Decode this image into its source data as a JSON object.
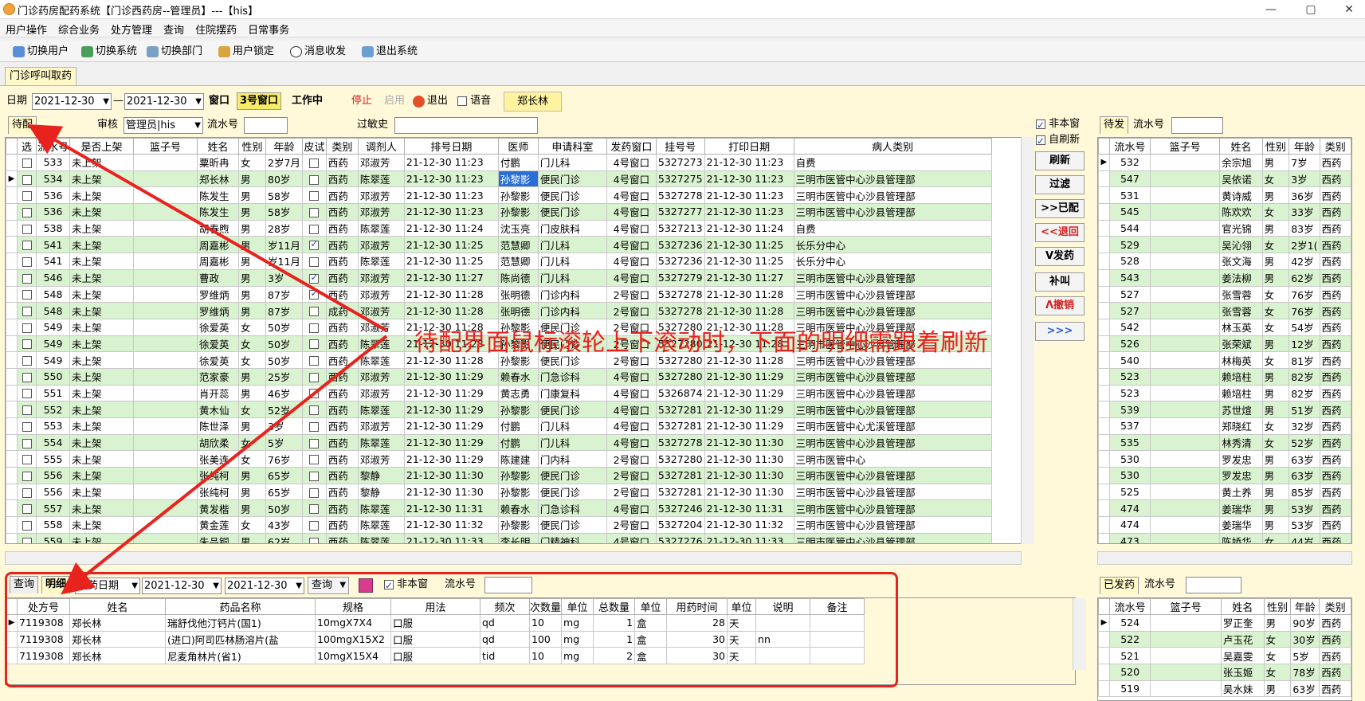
{
  "window": {
    "title": "门诊药房配药系统【门诊西药房--管理员】---【his】",
    "min": "—",
    "max": "▢",
    "close": "✕"
  },
  "menu": [
    "用户操作",
    "综合业务",
    "处方管理",
    "查询",
    "住院摆药",
    "日常事务"
  ],
  "toolbar": [
    "切换用户",
    "切换系统",
    "切换部门",
    "用户锁定",
    "消息收发",
    "退出系统"
  ],
  "module_tab": "门诊呼叫取药",
  "filter": {
    "date_label": "日期",
    "date_from": "2021-12-30",
    "dash": "—",
    "date_to": "2021-12-30",
    "window_label": "窗口",
    "window_value": "3号窗口",
    "status": "工作中",
    "stop": "停止",
    "enable": "启用",
    "exit": "退出",
    "voice": "语音",
    "user": "郑长林"
  },
  "left_tab": "待配",
  "review_label": "审核",
  "review_value": "管理员|his",
  "serial_label": "流水号",
  "allergy_label": "过敏史",
  "main_columns": [
    "选",
    "流水号",
    "是否上架",
    "篮子号",
    "姓名",
    "性别",
    "年龄",
    "皮试",
    "类别",
    "调剂人",
    "排号日期",
    "医师",
    "申请科室",
    "发药窗口",
    "挂号号",
    "打印日期",
    "病人类别"
  ],
  "main_rows": [
    [
      "533",
      "未上架",
      "",
      "粟昕冉",
      "女",
      "2岁7月",
      "0",
      "西药",
      "邓淑芳",
      "21-12-30 11:23",
      "付鹏",
      "门儿科",
      "4号窗口",
      "5327273",
      "21-12-30 11:23",
      "自费"
    ],
    [
      "534",
      "未上架",
      "",
      "郑长林",
      "男",
      "80岁",
      "0",
      "西药",
      "陈翠莲",
      "21-12-30 11:23",
      "孙黎影",
      "便民门诊",
      "4号窗口",
      "5327275",
      "21-12-30 11:23",
      "三明市医管中心沙县管理部"
    ],
    [
      "536",
      "未上架",
      "",
      "陈发生",
      "男",
      "58岁",
      "0",
      "西药",
      "邓淑芳",
      "21-12-30 11:23",
      "孙黎影",
      "便民门诊",
      "4号窗口",
      "5327278",
      "21-12-30 11:23",
      "三明市医管中心沙县管理部"
    ],
    [
      "536",
      "未上架",
      "",
      "陈发生",
      "男",
      "58岁",
      "0",
      "西药",
      "邓淑芳",
      "21-12-30 11:23",
      "孙黎影",
      "便民门诊",
      "4号窗口",
      "5327277",
      "21-12-30 11:23",
      "三明市医管中心沙县管理部"
    ],
    [
      "538",
      "未上架",
      "",
      "胡春煦",
      "男",
      "28岁",
      "0",
      "西药",
      "陈翠莲",
      "21-12-30 11:24",
      "沈玉亮",
      "门皮肤科",
      "4号窗口",
      "5327213",
      "21-12-30 11:24",
      "自费"
    ],
    [
      "541",
      "未上架",
      "",
      "周嘉彬",
      "男",
      "岁11月",
      "1",
      "西药",
      "邓淑芳",
      "21-12-30 11:25",
      "范慧卿",
      "门儿科",
      "4号窗口",
      "5327236",
      "21-12-30 11:25",
      "长乐分中心"
    ],
    [
      "541",
      "未上架",
      "",
      "周嘉彬",
      "男",
      "岁11月",
      "0",
      "西药",
      "陈翠莲",
      "21-12-30 11:25",
      "范慧卿",
      "门儿科",
      "4号窗口",
      "5327236",
      "21-12-30 11:25",
      "长乐分中心"
    ],
    [
      "546",
      "未上架",
      "",
      "曹政",
      "男",
      "3岁",
      "1",
      "西药",
      "邓淑芳",
      "21-12-30 11:27",
      "陈尚德",
      "门儿科",
      "4号窗口",
      "5327279",
      "21-12-30 11:27",
      "三明市医管中心沙县管理部"
    ],
    [
      "548",
      "未上架",
      "",
      "罗维炳",
      "男",
      "87岁",
      "1",
      "西药",
      "邓淑芳",
      "21-12-30 11:28",
      "张明德",
      "门诊内科",
      "2号窗口",
      "5327278",
      "21-12-30 11:28",
      "三明市医管中心沙县管理部"
    ],
    [
      "548",
      "未上架",
      "",
      "罗维炳",
      "男",
      "87岁",
      "0",
      "成药",
      "邓淑芳",
      "21-12-30 11:28",
      "张明德",
      "门诊内科",
      "2号窗口",
      "5327278",
      "21-12-30 11:28",
      "三明市医管中心沙县管理部"
    ],
    [
      "549",
      "未上架",
      "",
      "徐爱英",
      "女",
      "50岁",
      "0",
      "西药",
      "邓淑芳",
      "21-12-30 11:28",
      "孙黎影",
      "便民门诊",
      "2号窗口",
      "5327280",
      "21-12-30 11:28",
      "三明市医管中心沙县管理部"
    ],
    [
      "549",
      "未上架",
      "",
      "徐爱英",
      "女",
      "50岁",
      "0",
      "西药",
      "陈翠莲",
      "21-12-30 11:28",
      "孙黎影",
      "便民门诊",
      "2号窗口",
      "5327280",
      "21-12-30 11:28",
      "三明市医管中心沙县管理部"
    ],
    [
      "549",
      "未上架",
      "",
      "徐爱英",
      "女",
      "50岁",
      "0",
      "西药",
      "陈翠莲",
      "21-12-30 11:28",
      "孙黎影",
      "便民门诊",
      "2号窗口",
      "5327280",
      "21-12-30 11:28",
      "三明市医管中心沙县管理部"
    ],
    [
      "550",
      "未上架",
      "",
      "范家豪",
      "男",
      "25岁",
      "0",
      "西药",
      "邓淑芳",
      "21-12-30 11:29",
      "赖春水",
      "门急诊科",
      "4号窗口",
      "5327280",
      "21-12-30 11:29",
      "三明市医管中心沙县管理部"
    ],
    [
      "551",
      "未上架",
      "",
      "肖开蕊",
      "男",
      "46岁",
      "0",
      "西药",
      "邓淑芳",
      "21-12-30 11:29",
      "黄志勇",
      "门康复科",
      "4号窗口",
      "5326874",
      "21-12-30 11:29",
      "三明市医管中心沙县管理部"
    ],
    [
      "552",
      "未上架",
      "",
      "黄木仙",
      "女",
      "52岁",
      "0",
      "西药",
      "陈翠莲",
      "21-12-30 11:29",
      "孙黎影",
      "便民门诊",
      "4号窗口",
      "5327281",
      "21-12-30 11:29",
      "三明市医管中心沙县管理部"
    ],
    [
      "553",
      "未上架",
      "",
      "陈世泽",
      "男",
      "3岁",
      "0",
      "西药",
      "邓淑芳",
      "21-12-30 11:29",
      "付鹏",
      "门儿科",
      "4号窗口",
      "5327281",
      "21-12-30 11:29",
      "三明市医管中心尤溪管理部"
    ],
    [
      "554",
      "未上架",
      "",
      "胡欣柔",
      "女",
      "5岁",
      "0",
      "西药",
      "陈翠莲",
      "21-12-30 11:29",
      "付鹏",
      "门儿科",
      "4号窗口",
      "5327278",
      "21-12-30 11:30",
      "三明市医管中心沙县管理部"
    ],
    [
      "555",
      "未上架",
      "",
      "张美连",
      "女",
      "76岁",
      "0",
      "西药",
      "邓淑芳",
      "21-12-30 11:29",
      "陈建建",
      "门内科",
      "2号窗口",
      "5327280",
      "21-12-30 11:30",
      "三明市医管中心"
    ],
    [
      "556",
      "未上架",
      "",
      "张纯柯",
      "男",
      "65岁",
      "0",
      "西药",
      "黎静",
      "21-12-30 11:30",
      "孙黎影",
      "便民门诊",
      "2号窗口",
      "5327281",
      "21-12-30 11:30",
      "三明市医管中心沙县管理部"
    ],
    [
      "556",
      "未上架",
      "",
      "张纯柯",
      "男",
      "65岁",
      "0",
      "西药",
      "黎静",
      "21-12-30 11:30",
      "孙黎影",
      "便民门诊",
      "2号窗口",
      "5327281",
      "21-12-30 11:30",
      "三明市医管中心沙县管理部"
    ],
    [
      "557",
      "未上架",
      "",
      "黄发楷",
      "男",
      "50岁",
      "0",
      "西药",
      "陈翠莲",
      "21-12-30 11:31",
      "赖春水",
      "门急诊科",
      "4号窗口",
      "5327246",
      "21-12-30 11:31",
      "三明市医管中心沙县管理部"
    ],
    [
      "558",
      "未上架",
      "",
      "黄金莲",
      "女",
      "43岁",
      "0",
      "西药",
      "陈翠莲",
      "21-12-30 11:32",
      "孙黎影",
      "便民门诊",
      "2号窗口",
      "5327204",
      "21-12-30 11:32",
      "三明市医管中心沙县管理部"
    ],
    [
      "559",
      "未上架",
      "",
      "朱品铜",
      "男",
      "62岁",
      "0",
      "西药",
      "陈翠莲",
      "21-12-30 11:33",
      "李长明",
      "门精神科",
      "4号窗口",
      "5327276",
      "21-12-30 11:33",
      "三明市医管中心沙县管理部"
    ]
  ],
  "side": {
    "chk1": "非本窗",
    "chk2": "自刷新",
    "buttons": [
      "刷新",
      "过滤",
      ">>已配",
      "<<退回",
      "V发药",
      "补叫",
      "Λ撤销",
      ">>>"
    ]
  },
  "right_tab": "待发",
  "right_serial": "流水号",
  "right_columns": [
    "流水号",
    "篮子号",
    "姓名",
    "性别",
    "年龄",
    "类别"
  ],
  "right_rows": [
    [
      "532",
      "",
      "余宗旭",
      "男",
      "7岁",
      "西药"
    ],
    [
      "547",
      "",
      "吴依诺",
      "女",
      "3岁",
      "西药"
    ],
    [
      "531",
      "",
      "黄诗威",
      "男",
      "36岁",
      "西药"
    ],
    [
      "545",
      "",
      "陈欢欢",
      "女",
      "33岁",
      "西药"
    ],
    [
      "544",
      "",
      "官光锦",
      "男",
      "83岁",
      "西药"
    ],
    [
      "529",
      "",
      "吴沁翎",
      "女",
      "2岁1(",
      "西药"
    ],
    [
      "528",
      "",
      "张文海",
      "男",
      "42岁",
      "西药"
    ],
    [
      "543",
      "",
      "姜法柳",
      "男",
      "62岁",
      "西药"
    ],
    [
      "527",
      "",
      "张雪蓉",
      "女",
      "76岁",
      "西药"
    ],
    [
      "527",
      "",
      "张雪蓉",
      "女",
      "76岁",
      "西药"
    ],
    [
      "542",
      "",
      "林玉英",
      "女",
      "54岁",
      "西药"
    ],
    [
      "526",
      "",
      "张荣斌",
      "男",
      "12岁",
      "西药"
    ],
    [
      "540",
      "",
      "林梅英",
      "女",
      "81岁",
      "西药"
    ],
    [
      "523",
      "",
      "赖培柱",
      "男",
      "82岁",
      "西药"
    ],
    [
      "523",
      "",
      "赖培柱",
      "男",
      "82岁",
      "西药"
    ],
    [
      "539",
      "",
      "苏世煊",
      "男",
      "51岁",
      "西药"
    ],
    [
      "537",
      "",
      "郑晓红",
      "女",
      "32岁",
      "西药"
    ],
    [
      "535",
      "",
      "林秀清",
      "女",
      "52岁",
      "西药"
    ],
    [
      "530",
      "",
      "罗发忠",
      "男",
      "63岁",
      "西药"
    ],
    [
      "530",
      "",
      "罗发忠",
      "男",
      "63岁",
      "西药"
    ],
    [
      "525",
      "",
      "黄土养",
      "男",
      "85岁",
      "西药"
    ],
    [
      "474",
      "",
      "姜瑞华",
      "男",
      "53岁",
      "西药"
    ],
    [
      "474",
      "",
      "姜瑞华",
      "男",
      "53岁",
      "西药"
    ],
    [
      "473",
      "",
      "陈娇华",
      "女",
      "44岁",
      "西药"
    ]
  ],
  "bottom": {
    "tab1": "查询",
    "tab2": "明细",
    "date_type": "发药日期",
    "date_from": "2021-12-30",
    "date_to": "2021-12-30",
    "query": "查询",
    "chk": "非本窗",
    "serial": "流水号"
  },
  "detail_columns": [
    "处方号",
    "姓名",
    "药品名称",
    "规格",
    "用法",
    "频次",
    "次数量",
    "单位",
    "总数量",
    "单位",
    "用药时间",
    "单位",
    "说明",
    "备注"
  ],
  "detail_rows": [
    [
      "7119308",
      "郑长林",
      "瑞舒伐他汀钙片(国1)",
      "10mgX7X4",
      "口服",
      "qd",
      "10",
      "mg",
      "1",
      "盒",
      "28",
      "天",
      "",
      ""
    ],
    [
      "7119308",
      "郑长林",
      "(进口)阿司匹林肠溶片(盐",
      "100mgX15X2",
      "口服",
      "qd",
      "100",
      "mg",
      "1",
      "盒",
      "30",
      "天",
      "nn",
      ""
    ],
    [
      "7119308",
      "郑长林",
      "尼麦角林片(省1)",
      "10mgX15X4",
      "口服",
      "tid",
      "10",
      "mg",
      "2",
      "盒",
      "30",
      "天",
      "",
      ""
    ]
  ],
  "dispensed_tab": "已发药",
  "dispensed_serial": "流水号",
  "dispensed_rows": [
    [
      "524",
      "",
      "罗正奎",
      "男",
      "90岁",
      "西药"
    ],
    [
      "522",
      "",
      "卢玉花",
      "女",
      "30岁",
      "西药"
    ],
    [
      "521",
      "",
      "吴嘉雯",
      "女",
      "5岁",
      "西药"
    ],
    [
      "520",
      "",
      "张玉姬",
      "女",
      "78岁",
      "西药"
    ],
    [
      "519",
      "",
      "吴水妹",
      "男",
      "63岁",
      "西药"
    ]
  ],
  "annotation": "待配界面鼠标滚轮上下滚动时，下面的明细需跟着刷新",
  "colors": {
    "panel_bg": "#fff9d9",
    "row_green": "#d9f2cf",
    "annotation_red": "#e8231e",
    "selection_blue": "#2a6fd6"
  }
}
